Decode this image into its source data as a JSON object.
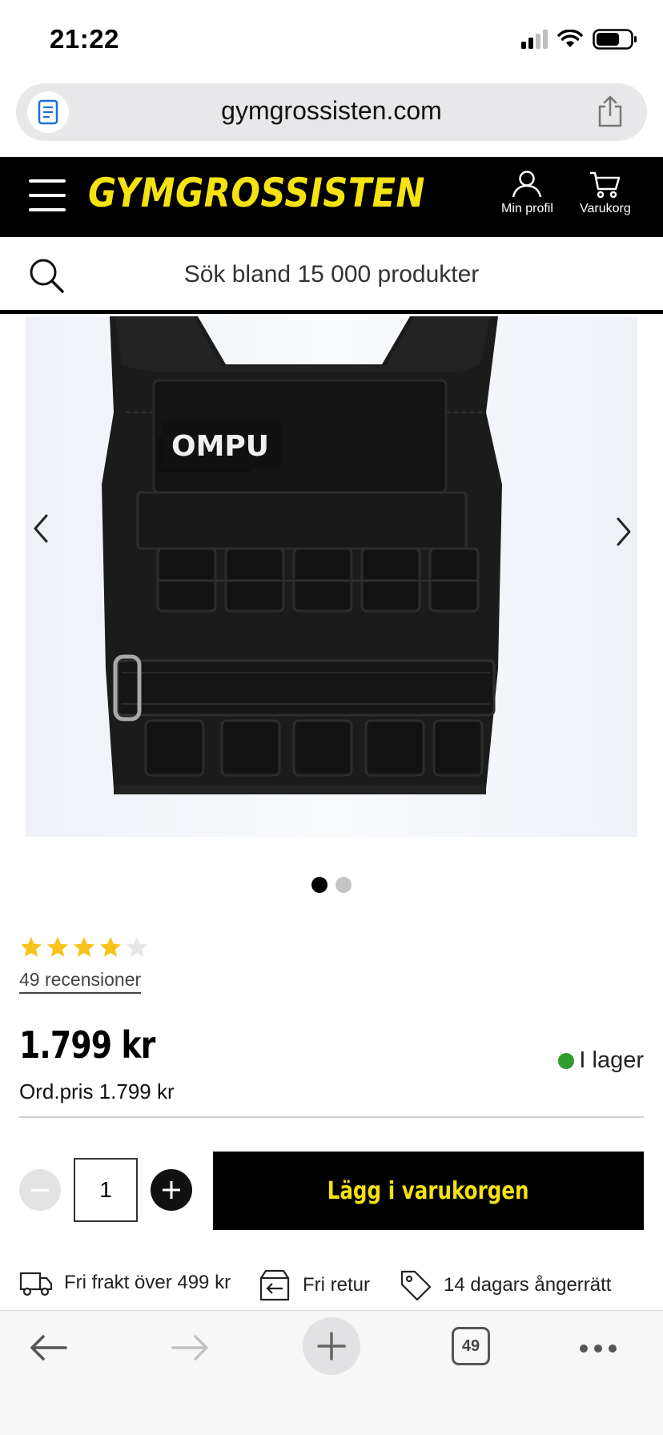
{
  "status_bar": {
    "time": "21:22"
  },
  "url_bar": {
    "domain": "gymgrossisten.com",
    "reader_icon": "reader-icon",
    "share_icon": "share-icon"
  },
  "header": {
    "logo": "GYMGROSSISTEN",
    "menu_icon": "hamburger-menu-icon",
    "profile_label": "Min profil",
    "cart_label": "Varukorg",
    "accent_color": "#f5e211"
  },
  "search": {
    "placeholder": "Sök bland 15 000 produkter"
  },
  "product": {
    "image_brand_text": "OMPU",
    "image_count": 2,
    "current_image": 1,
    "rating": 4,
    "rating_max": 5,
    "reviews_label": "49 recensioner",
    "price": "1.799 kr",
    "ordinary_price": "Ord.pris 1.799 kr",
    "stock_status": "I lager",
    "stock_color": "#2e9d2e"
  },
  "purchase": {
    "quantity": "1",
    "add_to_cart_label": "Lägg i varukorgen"
  },
  "usps": [
    {
      "icon": "truck-icon",
      "label": "Fri frakt över 499 kr"
    },
    {
      "icon": "return-box-icon",
      "label": "Fri retur"
    },
    {
      "icon": "price-tag-icon",
      "label": "14 dagars ångerrätt"
    }
  ],
  "toolbar": {
    "tab_count": "49"
  }
}
